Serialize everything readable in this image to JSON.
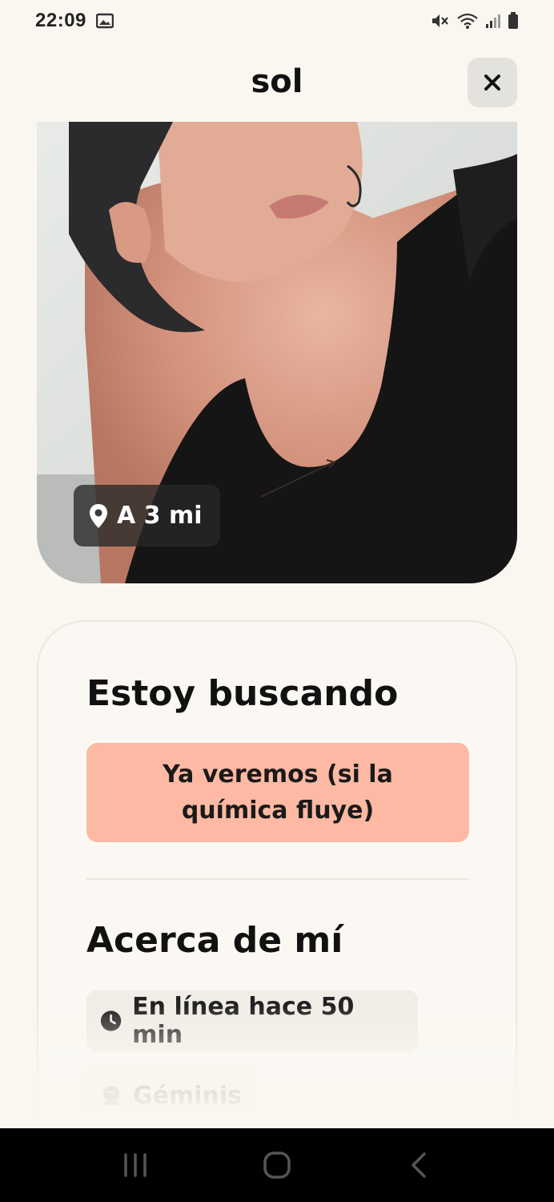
{
  "status_bar": {
    "time": "22:09",
    "icons": [
      "gallery-icon",
      "mute-icon",
      "wifi-icon",
      "signal-icon",
      "battery-icon"
    ]
  },
  "header": {
    "title": "sol",
    "close_icon": "close-icon"
  },
  "photo": {
    "distance": "A 3 mi",
    "distance_icon": "location-pin-icon"
  },
  "looking_for": {
    "title": "Estoy buscando",
    "value": "Ya veremos (si la química fluye)",
    "chip_color": "#fdb9a3"
  },
  "about": {
    "title": "Acerca de mí",
    "chips": [
      {
        "icon": "clock-icon",
        "label": "En línea hace 50 min"
      },
      {
        "icon": "zodiac-icon",
        "label": "Géminis"
      }
    ]
  },
  "nav_bar": {
    "buttons": [
      "recent-apps-icon",
      "home-icon",
      "back-icon"
    ]
  },
  "colors": {
    "background": "#faf7f1",
    "chip_bg": "#f0ece6",
    "close_bg": "#e4e2dd"
  }
}
